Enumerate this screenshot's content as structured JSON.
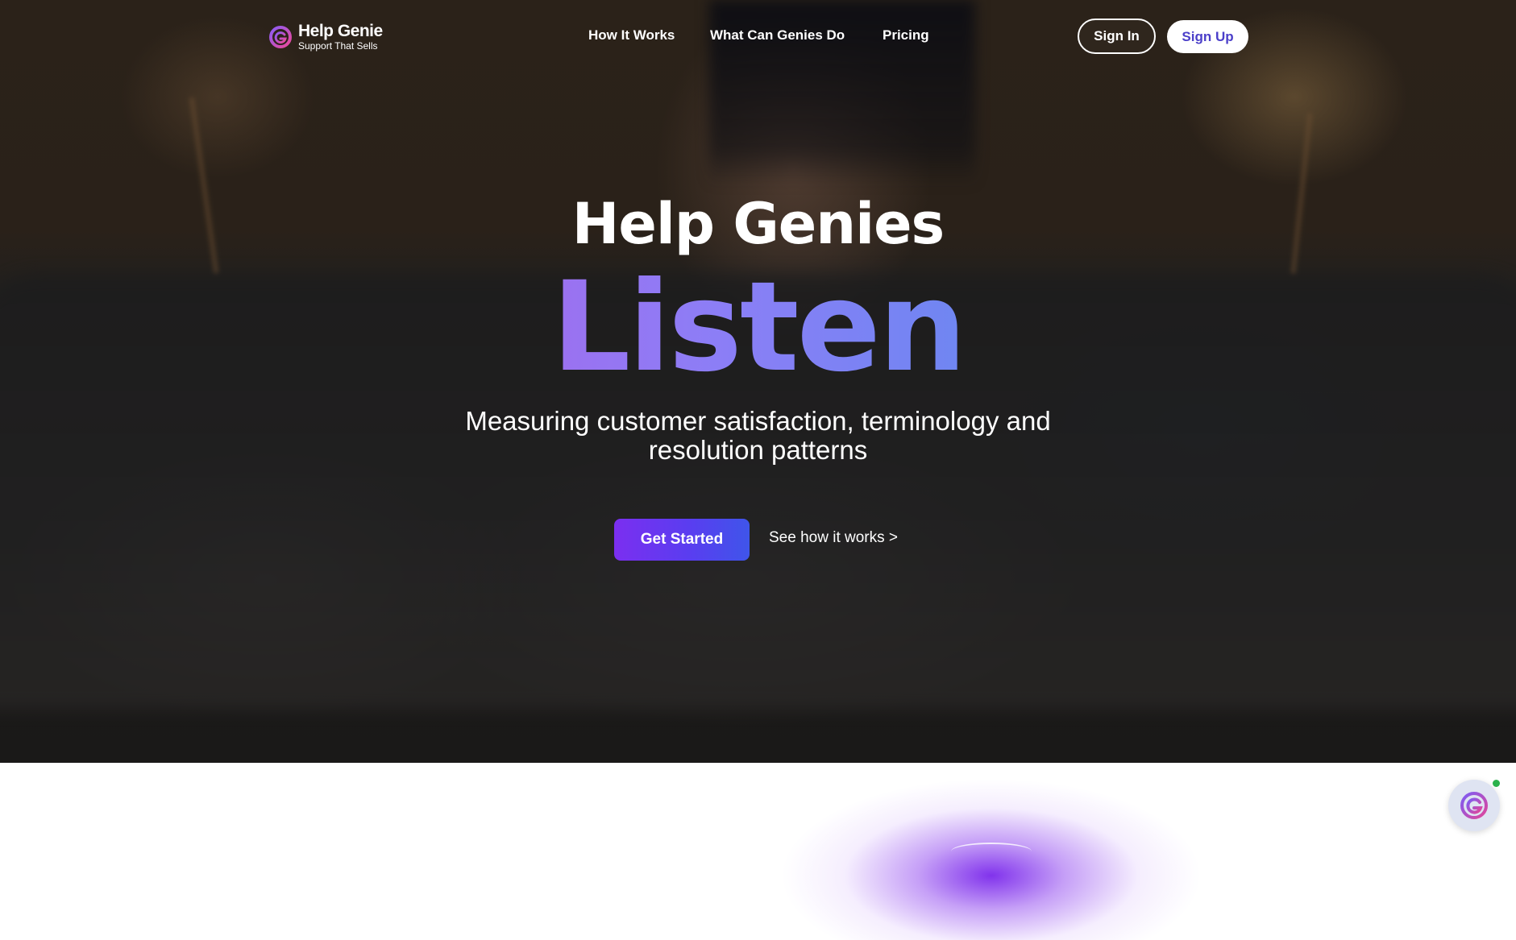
{
  "brand": {
    "name": "Help Genie",
    "tagline": "Support That Sells",
    "logo_icon": "genie-logo-icon"
  },
  "nav": {
    "items": [
      {
        "label": "How It Works"
      },
      {
        "label": "What Can Genies Do"
      },
      {
        "label": "Pricing"
      }
    ]
  },
  "auth": {
    "sign_in_label": "Sign In",
    "sign_up_label": "Sign Up"
  },
  "hero": {
    "title": "Help Genies",
    "highlight_word": "Listen",
    "subtitle": "Measuring customer satisfaction, terminology and resolution patterns",
    "primary_cta": "Get Started",
    "secondary_cta": "See how it works >"
  },
  "chat_widget": {
    "icon": "genie-chat-icon",
    "status": "online"
  },
  "colors": {
    "accent_purple": "#7b2ff0",
    "accent_blue": "#3f55ea",
    "highlight_gradient_start": "#9b71f0",
    "highlight_gradient_end": "#6f86f2",
    "sign_up_text": "#4b3fc9",
    "online_dot": "#2bb24c"
  }
}
